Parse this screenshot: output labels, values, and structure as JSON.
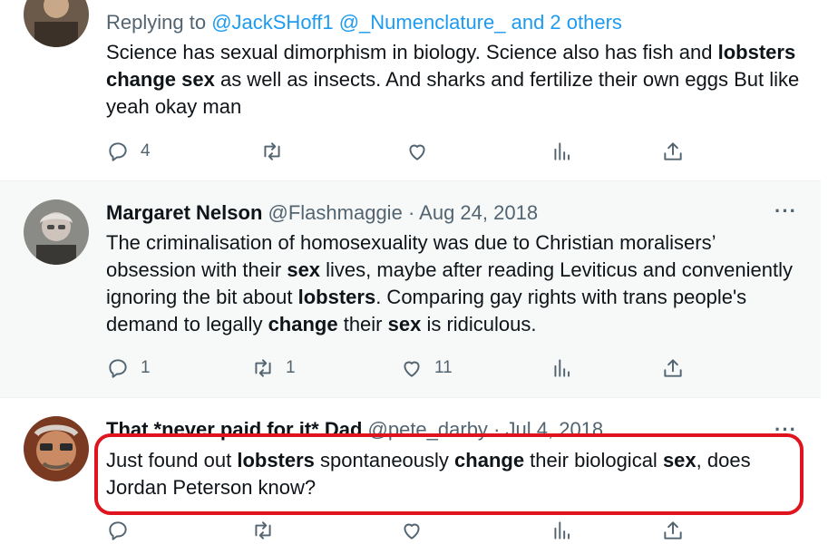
{
  "tweets": [
    {
      "name": "",
      "handle": "",
      "date": "",
      "replying_prefix": "Replying to ",
      "replying_users": "@JackSHoff1 @_Numenclature_ and 2 others",
      "body_segments": [
        {
          "text": "Science has sexual dimorphism in biology. Science also has fish and ",
          "bold": false
        },
        {
          "text": "lobsters change sex",
          "bold": true
        },
        {
          "text": " as well as insects. And sharks and fertilize their own eggs But like yeah okay man",
          "bold": false
        }
      ],
      "replies": "4",
      "retweets": "",
      "likes": "",
      "views": ""
    },
    {
      "name": "Margaret Nelson",
      "handle": "@Flashmaggie",
      "separator": "·",
      "date": "Aug 24, 2018",
      "body_segments": [
        {
          "text": "The criminalisation of homosexuality was due to Christian moralisers’ obsession with their ",
          "bold": false
        },
        {
          "text": "sex",
          "bold": true
        },
        {
          "text": " lives, maybe after reading Leviticus and conveniently ignoring the bit about ",
          "bold": false
        },
        {
          "text": "lobsters",
          "bold": true
        },
        {
          "text": ". Comparing gay rights with trans people's demand to legally ",
          "bold": false
        },
        {
          "text": "change",
          "bold": true
        },
        {
          "text": " their ",
          "bold": false
        },
        {
          "text": "sex",
          "bold": true
        },
        {
          "text": " is ridiculous.",
          "bold": false
        }
      ],
      "replies": "1",
      "retweets": "1",
      "likes": "11",
      "views": ""
    },
    {
      "name": "That *never paid for it* Dad",
      "handle": "@pete_darby",
      "separator": "·",
      "date": "Jul 4, 2018",
      "body_segments": [
        {
          "text": "Just found out ",
          "bold": false
        },
        {
          "text": "lobsters",
          "bold": true
        },
        {
          "text": " spontaneously ",
          "bold": false
        },
        {
          "text": "change",
          "bold": true
        },
        {
          "text": " their biological ",
          "bold": false
        },
        {
          "text": "sex",
          "bold": true
        },
        {
          "text": ", does Jordan Peterson know?",
          "bold": false
        }
      ],
      "replies": "",
      "retweets": "",
      "likes": "",
      "views": ""
    }
  ],
  "more_glyph": "···",
  "colors": {
    "text": "#0f1419",
    "muted": "#536471",
    "link": "#1d9bf0",
    "highlight": "#e0141e",
    "shaded_bg": "#f7f9f9"
  },
  "icons": [
    "reply-icon",
    "retweet-icon",
    "like-icon",
    "views-icon",
    "share-icon",
    "more-icon"
  ]
}
